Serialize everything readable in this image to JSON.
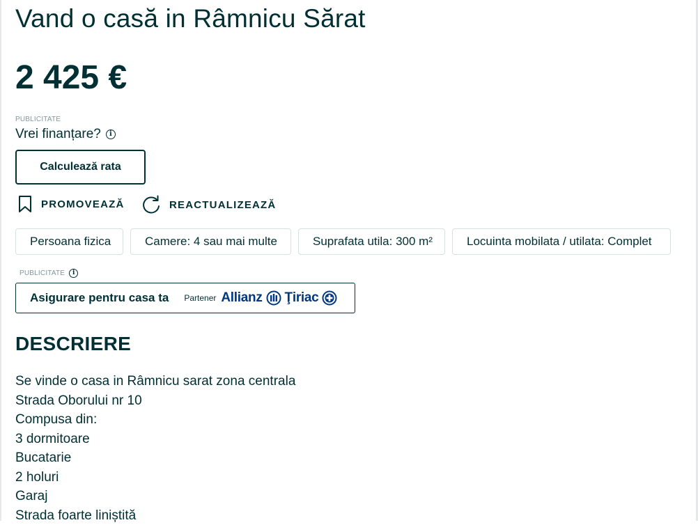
{
  "listing": {
    "title": "Vand o casă in Râmnicu Sărat",
    "price": "2 425 €"
  },
  "financing": {
    "ad_label": "PUBLICITATE",
    "question": "Vrei finanțare?",
    "calc_button": "Calculează rata"
  },
  "actions": {
    "promote": "PROMOVEAZĂ",
    "refresh": "REACTUALIZEAZĂ"
  },
  "tags": [
    "Persoana fizica",
    "Camere: 4 sau mai multe",
    "Suprafata utila: 300 m²",
    "Locuinta mobilata / utilata: Complet"
  ],
  "insurance": {
    "ad_label": "PUBLICITATE",
    "text": "Asigurare pentru casa ta",
    "partner_label": "Partener",
    "brand_left": "Allianz",
    "brand_right": "Ţiriac"
  },
  "description": {
    "heading": "DESCRIERE",
    "lines": [
      "Se vinde o casa in Râmnicu sarat zona centrala",
      "Strada Oborului nr 10",
      "Compusa din:",
      "3 dormitoare",
      "Bucatarie",
      "2 holuri",
      "Garaj",
      "Strada foarte liniștită"
    ]
  },
  "colors": {
    "text": "#002f34",
    "border": "#d8dfe0",
    "brand": "#003781",
    "muted": "#7f9799"
  },
  "icons": [
    "info-icon",
    "bookmark-icon",
    "refresh-icon",
    "allianz-logo-icon",
    "tiriac-logo-icon"
  ]
}
